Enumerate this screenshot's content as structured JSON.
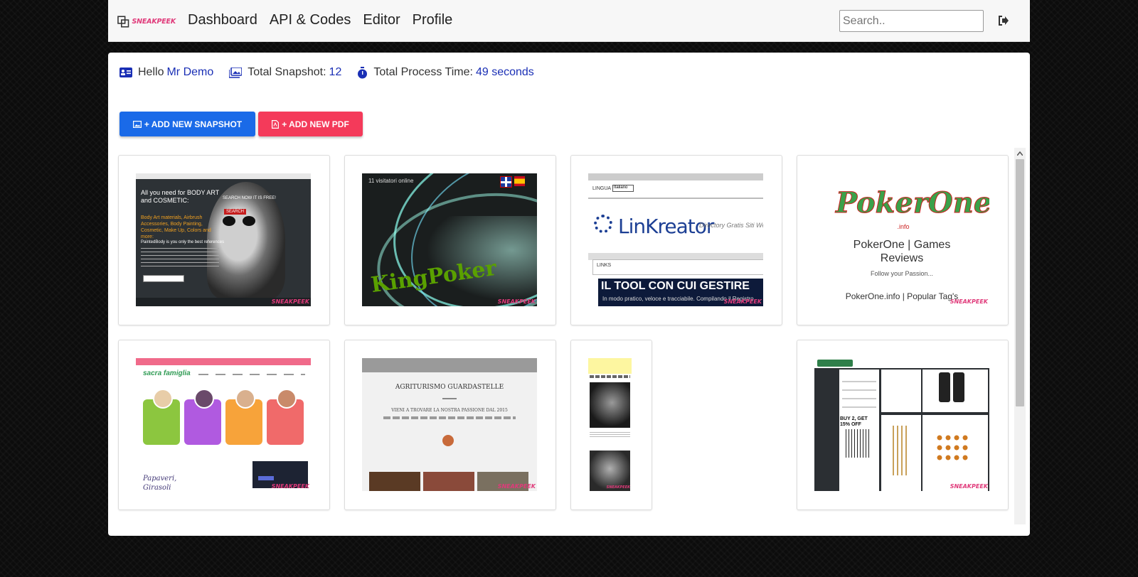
{
  "brand": {
    "logo_text": "SNEAKPEEK"
  },
  "nav": {
    "items": [
      "Dashboard",
      "API & Codes",
      "Editor",
      "Profile"
    ]
  },
  "search": {
    "placeholder": "Search.."
  },
  "stats": {
    "hello_label": "Hello",
    "user_name": "Mr Demo",
    "snapshot_label": "Total Snapshot:",
    "snapshot_count": "12",
    "process_label": "Total Process Time:",
    "process_time": "49 seconds"
  },
  "actions": {
    "add_snapshot_label": "+ ADD NEW SNAPSHOT",
    "add_pdf_label": "+ ADD NEW PDF"
  },
  "snapshots": [
    {
      "texts": [
        "All you need for BODY ART and COSMETIC:",
        "SEARCH NOW IT IS FREE!",
        "SEARCH",
        "Body Art materials, Airbrush Accessories, Body Painting, Cosmetic, Make Up, Colors and more:",
        "PaintedBody is you only the best references"
      ]
    },
    {
      "texts": [
        "11 visitatori online",
        "KingPoker"
      ]
    },
    {
      "texts": [
        "LINGUA",
        "Italiano",
        "LinKreator",
        "Directory Gratis Siti Web",
        "LINKS",
        "IL TOOL CON CUI GESTIRE",
        "In modo pratico, veloce e tracciabile. Compilando il Registro"
      ]
    },
    {
      "texts": [
        "PokerOne",
        ".info",
        "PokerOne | Games",
        "Reviews",
        "Follow your Passion...",
        "PokerOne.info | Popular Tag's"
      ]
    },
    {
      "texts": [
        "sacra famiglia",
        "Papaveri,",
        "Girasoli"
      ]
    },
    {
      "texts": [
        "AGRITURISMO GUARDASTELLE",
        "VIENI A TROVARE LA NOSTRA PASSIONE DAL 2015"
      ]
    },
    {
      "texts": []
    },
    {
      "texts": [
        "BUY 2, GET 15% OFF"
      ]
    }
  ],
  "colors": {
    "accent_blue": "#1a6ae8",
    "accent_red": "#f43a5a",
    "value_blue": "#1a2fb5",
    "brand_pink": "#e03a7a"
  }
}
